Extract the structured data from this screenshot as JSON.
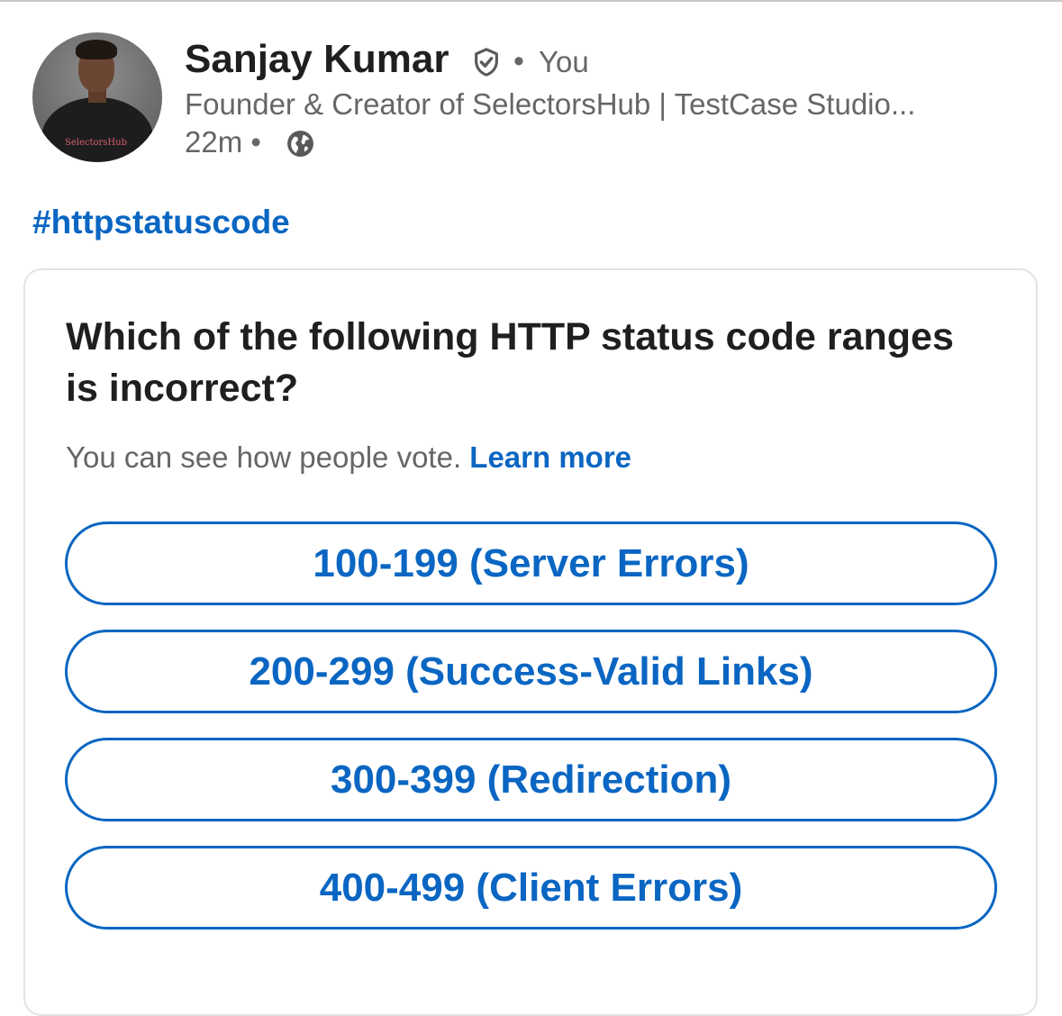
{
  "post": {
    "author_name": "Sanjay Kumar",
    "separator": "•",
    "relation": "You",
    "headline": "Founder & Creator of SelectorsHub | TestCase Studio...",
    "timestamp": "22m",
    "visibility_icon": "globe-icon",
    "verified_icon": "verified-shield-icon",
    "avatar_shirt_text": "SelectorsHub",
    "hashtag": "#httpstatuscode"
  },
  "poll": {
    "question": "Which of the following HTTP status code ranges is incorrect?",
    "vote_note": "You can see how people vote.",
    "learn_more": "Learn more",
    "options": [
      {
        "label": "100-199 (Server Errors)"
      },
      {
        "label": "200-299 (Success-Valid Links)"
      },
      {
        "label": "300-399 (Redirection)"
      },
      {
        "label": "400-499 (Client Errors)"
      }
    ]
  },
  "colors": {
    "accent": "#0a66c2",
    "text_primary": "#1f1f1f",
    "text_secondary": "#666666",
    "card_border": "#e3e3e3"
  }
}
